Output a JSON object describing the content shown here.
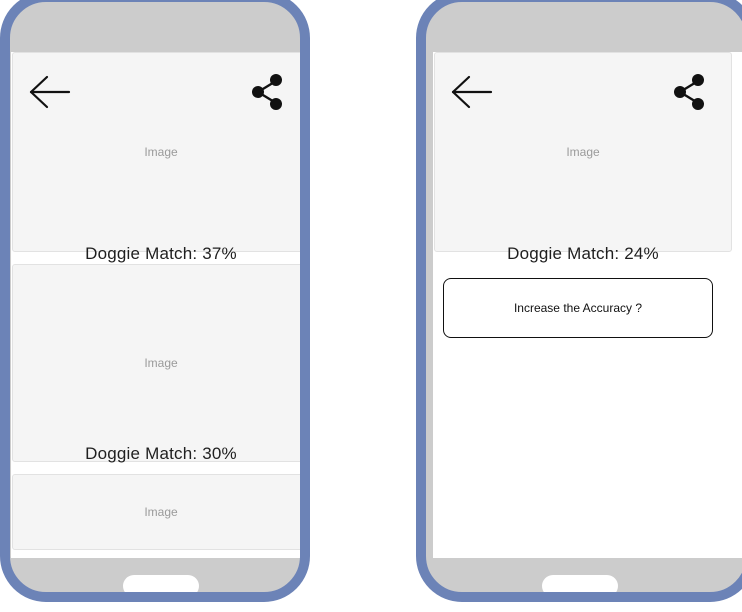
{
  "left_phone": {
    "image_label_1": "Image",
    "match_1": "Doggie Match: 37%",
    "image_label_2": "Image",
    "match_2": "Doggie Match: 30%",
    "image_label_3": "Image"
  },
  "right_phone": {
    "image_label_1": "Image",
    "match_1": "Doggie Match: 24%",
    "accuracy_button": "Increase the Accuracy  ?"
  },
  "icons": {
    "back": "back-arrow-icon",
    "share": "share-icon"
  },
  "colors": {
    "phone_frame": "#6c83b7",
    "phone_bezel": "#cccccc",
    "placeholder_bg": "#f5f5f5",
    "placeholder_text": "#9a9a9a"
  }
}
